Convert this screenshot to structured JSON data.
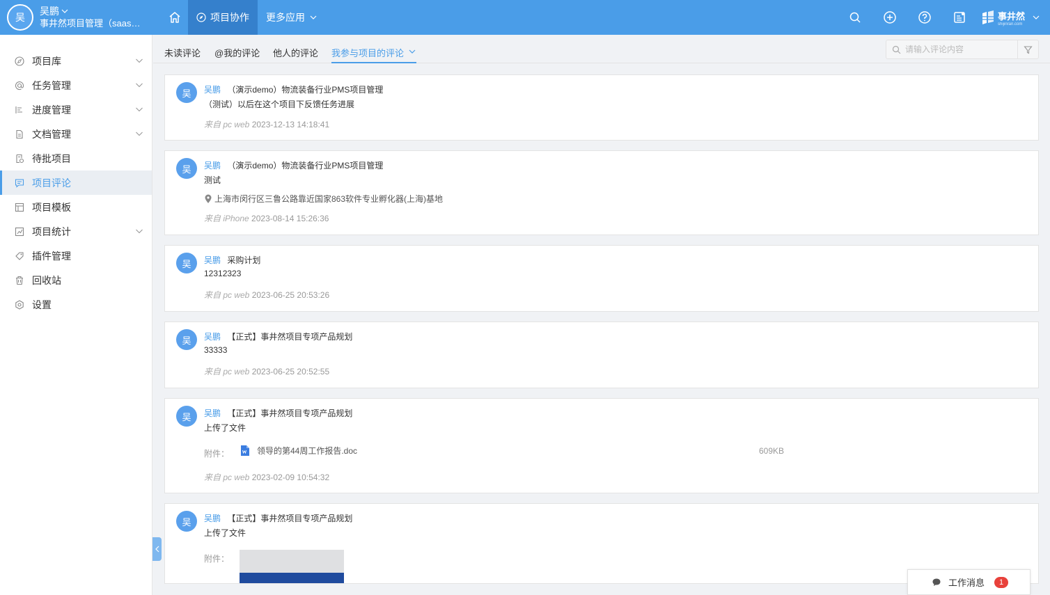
{
  "user": {
    "avatar_char": "吴",
    "name": "吴鹏",
    "org": "事井然项目管理（saas版）"
  },
  "nav": {
    "items": [
      {
        "label": "项目协作"
      },
      {
        "label": "更多应用"
      }
    ]
  },
  "brand": {
    "name": "事井然",
    "sub": "shijinran.com"
  },
  "colors": {
    "primary": "#4a9de8",
    "nav_active": "#3580cc",
    "badge": "#e8413b"
  },
  "sidebar": {
    "items": [
      {
        "label": "项目库",
        "icon": "compass-icon",
        "has_children": true
      },
      {
        "label": "任务管理",
        "icon": "at-icon",
        "has_children": true
      },
      {
        "label": "进度管理",
        "icon": "gantt-icon",
        "has_children": true
      },
      {
        "label": "文档管理",
        "icon": "document-icon",
        "has_children": true
      },
      {
        "label": "待批项目",
        "icon": "approval-icon",
        "has_children": false
      },
      {
        "label": "项目评论",
        "icon": "comment-icon",
        "has_children": false,
        "active": true
      },
      {
        "label": "项目模板",
        "icon": "template-icon",
        "has_children": false
      },
      {
        "label": "项目统计",
        "icon": "chart-icon",
        "has_children": true
      },
      {
        "label": "插件管理",
        "icon": "plugin-icon",
        "has_children": false
      },
      {
        "label": "回收站",
        "icon": "trash-icon",
        "has_children": false
      },
      {
        "label": "设置",
        "icon": "settings-icon",
        "has_children": false
      }
    ]
  },
  "tabs": [
    {
      "label": "未读评论"
    },
    {
      "label": "@我的评论"
    },
    {
      "label": "他人的评论"
    },
    {
      "label": "我参与项目的评论",
      "active": true
    }
  ],
  "search": {
    "placeholder": "请输入评论内容"
  },
  "comments": [
    {
      "author": "吴鹏",
      "project": "（演示demo）物流装备行业PMS项目管理",
      "body": "（测试）以后在这个项目下反馈任务进展",
      "source": "来自 pc web",
      "time": "2023-12-13 14:18:41"
    },
    {
      "author": "吴鹏",
      "project": "（演示demo）物流装备行业PMS项目管理",
      "body": "测试",
      "location": "上海市闵行区三鲁公路靠近国家863软件专业孵化器(上海)基地",
      "source": "来自 iPhone",
      "time": "2023-08-14 15:26:36"
    },
    {
      "author": "吴鹏",
      "project": "采购计划",
      "body": "12312323",
      "source": "来自 pc web",
      "time": "2023-06-25 20:53:26"
    },
    {
      "author": "吴鹏",
      "project": "【正式】事井然项目专项产品规划",
      "body": "33333",
      "source": "来自 pc web",
      "time": "2023-06-25 20:52:55"
    },
    {
      "author": "吴鹏",
      "project": "【正式】事井然项目专项产品规划",
      "body": "上传了文件",
      "attach_label": "附件：",
      "attach_name": "领导的第44周工作报告.doc",
      "attach_size": "609KB",
      "source": "来自 pc web",
      "time": "2023-02-09 10:54:32"
    },
    {
      "author": "吴鹏",
      "project": "【正式】事井然项目专项产品规划",
      "body": "上传了文件",
      "attach_label": "附件："
    }
  ],
  "workmsg": {
    "label": "工作消息",
    "count": "1"
  }
}
